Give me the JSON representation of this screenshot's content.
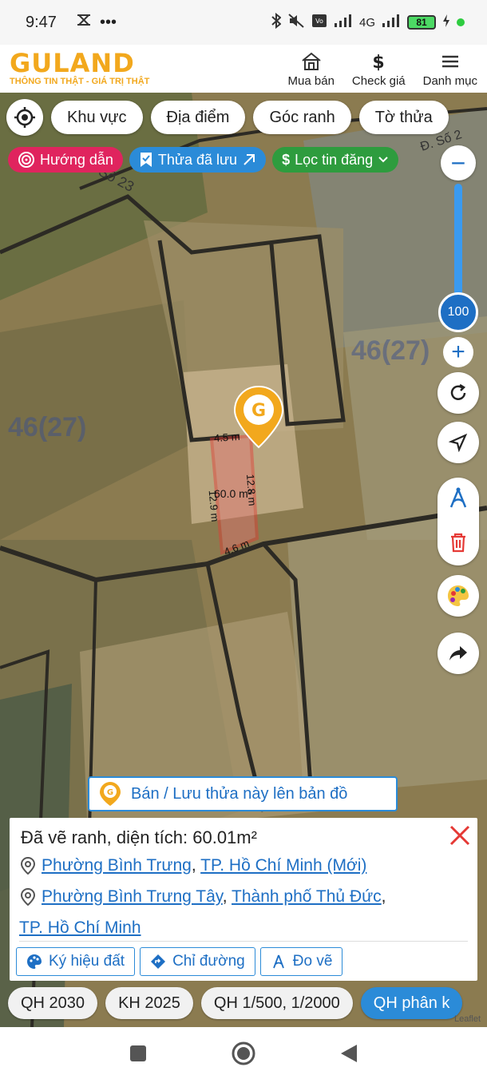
{
  "status_bar": {
    "time": "9:47",
    "signal_label": "4G",
    "battery": "81"
  },
  "header": {
    "logo": "GULAND",
    "tagline": "THÔNG TIN THẬT - GIÁ TRỊ THẬT",
    "nav": [
      {
        "label": "Mua bán",
        "icon": "house-icon"
      },
      {
        "label": "Check giá",
        "icon": "dollar-icon"
      },
      {
        "label": "Danh mục",
        "icon": "menu-icon"
      }
    ]
  },
  "filters": [
    "Khu vực",
    "Địa điểm",
    "Góc ranh",
    "Tờ thửa"
  ],
  "pills": {
    "guide": "Hướng dẫn",
    "saved": "Thửa đã lưu",
    "filter": "Lọc tin đăng"
  },
  "zoom": {
    "level": "100",
    "minus": "−",
    "plus": "+"
  },
  "map_labels": {
    "street": "Số 23",
    "street2": "Đ. Số 2",
    "parcel_left": "46(27)",
    "parcel_right": "46(27)",
    "top_edge": "4.5 m",
    "right_edge": "12.8 m",
    "left_edge": "12.9 m",
    "bottom_edge": "4.6 m",
    "area": "60.0 m²"
  },
  "sell_banner": "Bán / Lưu thửa này lên bản đồ",
  "info": {
    "title": "Đã vẽ ranh, diện tích: 60.01m²",
    "new_ward": "Phường Bình Trưng",
    "new_city": "TP. Hồ Chí Minh (Mới)",
    "old_ward": "Phường Bình Trưng Tây",
    "old_district": "Thành phố Thủ Đức",
    "old_city": "TP. Hồ Chí Minh",
    "sep": ","
  },
  "card_actions": [
    "Ký hiệu đất",
    "Chỉ đường",
    "Đo vẽ"
  ],
  "planning_chips": [
    "QH 2030",
    "KH 2025",
    "QH 1/500, 1/2000",
    "QH phân k"
  ],
  "attribution": "Leaflet",
  "colors": {
    "brand": "#f2a81d",
    "accent": "#1e6fc4",
    "parcel": "#e53935"
  }
}
